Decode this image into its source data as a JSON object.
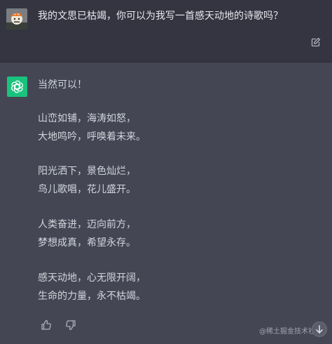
{
  "conversation": {
    "user_message": "我的文思已枯竭，你可以为我写一首感天动地的诗歌吗？",
    "assistant": {
      "intro": "当然可以！",
      "stanzas": [
        [
          "山峦如铺，海涛如怒，",
          "大地鸣吟，呼唤着未来。"
        ],
        [
          "阳光洒下，景色灿烂，",
          "鸟儿歌唱，花儿盛开。"
        ],
        [
          "人类奋进，迈向前方，",
          "梦想成真，希望永存。"
        ],
        [
          "感天动地，心无限开阔，",
          "生命的力量，永不枯竭。"
        ]
      ]
    }
  },
  "icons": {
    "edit": "edit-icon",
    "bot": "openai-logo-icon",
    "thumbs_up": "thumbs-up-icon",
    "thumbs_down": "thumbs-down-icon",
    "scroll_down": "arrow-down-icon"
  },
  "watermark": "@稀土掘金技术社区",
  "colors": {
    "user_bg": "#343541",
    "assistant_bg": "#444654",
    "bot_avatar": "#19c37d",
    "text": "#d1d5db"
  }
}
